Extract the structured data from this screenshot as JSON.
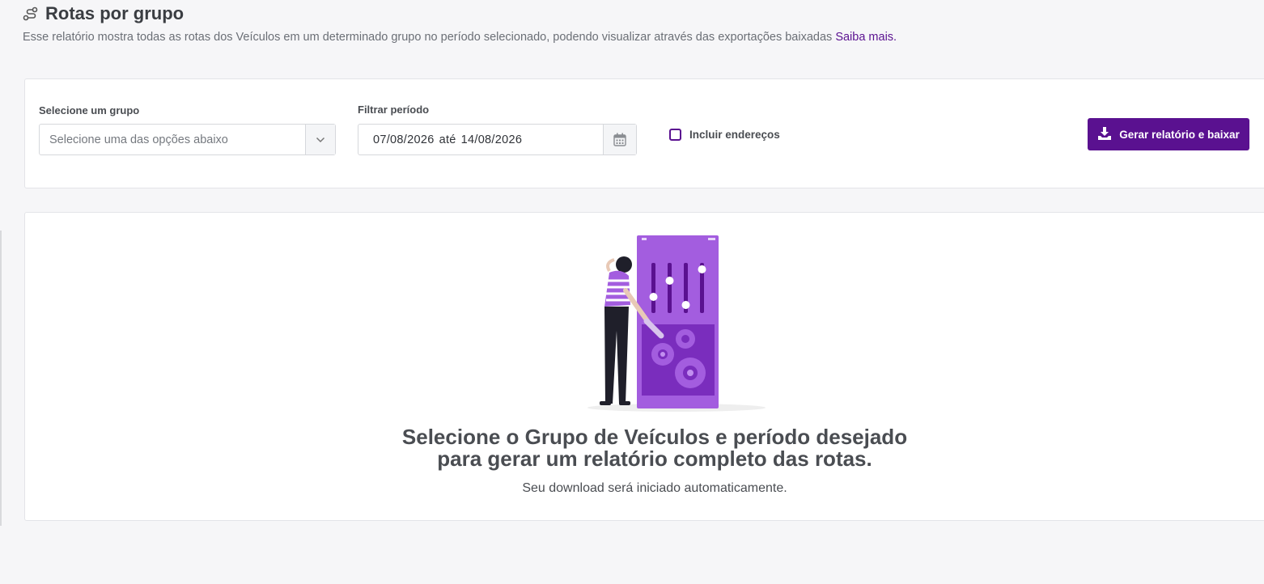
{
  "header": {
    "title": "Rotas por grupo",
    "description": "Esse relatório mostra todas as rotas dos Veículos em um determinado grupo no período selecionado, podendo visualizar através das exportações baixadas",
    "learn_more": "Saiba mais."
  },
  "filters": {
    "group_label": "Selecione um grupo",
    "group_placeholder": "Selecione uma das opções abaixo",
    "period_label": "Filtrar período",
    "date_start": "07/08/2026",
    "date_separator": "até",
    "date_end": "14/08/2026",
    "include_addresses_label": "Incluir endereços",
    "include_addresses_checked": false,
    "generate_button": "Gerar relatório e baixar"
  },
  "empty_state": {
    "heading_line1": "Selecione o Grupo de Veículos e período desejado",
    "heading_line2": "para gerar um relatório completo das rotas.",
    "subtext": "Seu download será iniciado automaticamente."
  },
  "colors": {
    "accent": "#5a1190",
    "illustration_purple": "#a35ddf",
    "text": "#3a3d42"
  }
}
